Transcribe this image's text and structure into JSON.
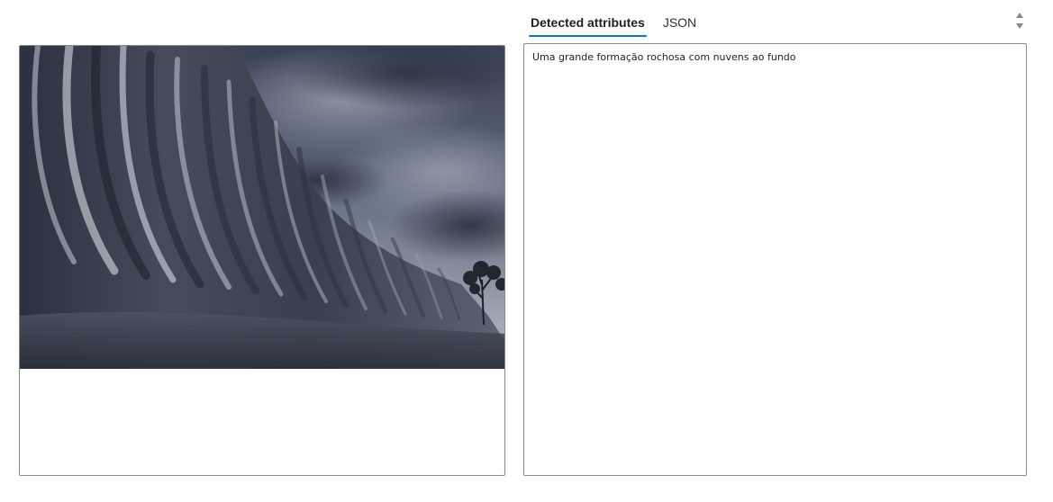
{
  "tabs": [
    {
      "label": "Detected attributes",
      "active": true
    },
    {
      "label": "JSON",
      "active": false
    }
  ],
  "image": {
    "alt": "Wave rock formation under stormy clouds"
  },
  "result": {
    "caption": "Uma grande formação rochosa com nuvens ao fundo"
  },
  "icons": {
    "scroll_up": "chevron-up-icon",
    "scroll_down": "chevron-down-icon"
  },
  "colors": {
    "accent": "#0078d4",
    "border": "#8a8886",
    "text": "#201f1e"
  }
}
